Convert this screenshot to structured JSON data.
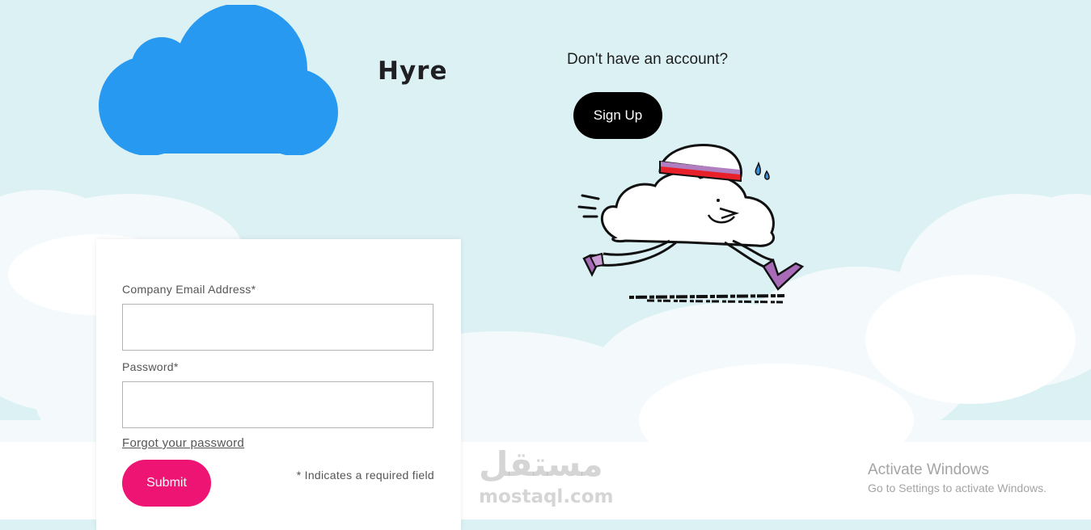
{
  "brand": {
    "name": "Hyre"
  },
  "signup": {
    "prompt": "Don't have an account?",
    "button_label": "Sign Up"
  },
  "login_form": {
    "email_label": "Company Email Address*",
    "email_value": "",
    "password_label": "Password*",
    "password_value": "",
    "forgot_link": "Forgot your password",
    "submit_label": "Submit",
    "required_note": "* Indicates a required field"
  },
  "watermark": {
    "arabic": "مستقل",
    "latin": "mostaql.com"
  },
  "os_notice": {
    "title": "Activate Windows",
    "subtitle": "Go to Settings to activate Windows."
  },
  "colors": {
    "sky": "#dcf1f4",
    "logo_cloud": "#2899f0",
    "signup_button": "#000000",
    "submit_button": "#ee1474"
  },
  "icons": {
    "logo": "cloud-logo-icon",
    "mascot": "running-cloud-mascot"
  }
}
